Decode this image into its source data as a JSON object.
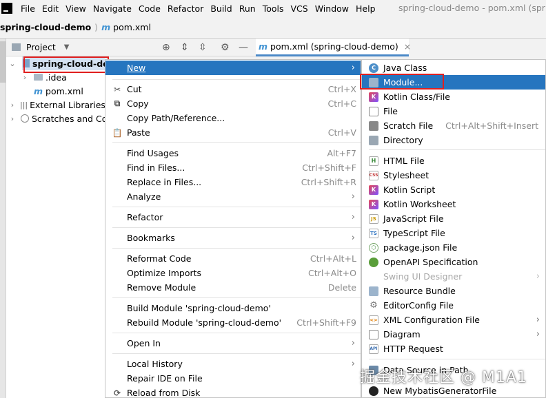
{
  "menubar": {
    "items": [
      "File",
      "Edit",
      "View",
      "Navigate",
      "Code",
      "Refactor",
      "Build",
      "Run",
      "Tools",
      "VCS",
      "Window",
      "Help"
    ],
    "window_title": "spring-cloud-demo - pom.xml (spring"
  },
  "navbar": {
    "project": "spring-cloud-demo",
    "file": "pom.xml"
  },
  "project_panel": {
    "title": "Project"
  },
  "editor_tab": {
    "label": "pom.xml (spring-cloud-demo)"
  },
  "tree": {
    "root": "spring-cloud-demo",
    "items": [
      ".idea",
      "pom.xml",
      "External Libraries",
      "Scratches and Co"
    ]
  },
  "context_menu": {
    "new": "New",
    "cut": "Cut",
    "cut_sc": "Ctrl+X",
    "copy": "Copy",
    "copy_sc": "Ctrl+C",
    "copy_path": "Copy Path/Reference...",
    "paste": "Paste",
    "paste_sc": "Ctrl+V",
    "find_usages": "Find Usages",
    "find_usages_sc": "Alt+F7",
    "find_in_files": "Find in Files...",
    "find_in_files_sc": "Ctrl+Shift+F",
    "replace_in_files": "Replace in Files...",
    "replace_in_files_sc": "Ctrl+Shift+R",
    "analyze": "Analyze",
    "refactor": "Refactor",
    "bookmarks": "Bookmarks",
    "reformat": "Reformat Code",
    "reformat_sc": "Ctrl+Alt+L",
    "optimize": "Optimize Imports",
    "optimize_sc": "Ctrl+Alt+O",
    "remove_module": "Remove Module",
    "remove_module_sc": "Delete",
    "build_module": "Build Module 'spring-cloud-demo'",
    "rebuild_module": "Rebuild Module 'spring-cloud-demo'",
    "rebuild_module_sc": "Ctrl+Shift+F9",
    "open_in": "Open In",
    "local_history": "Local History",
    "repair_ide": "Repair IDE on File",
    "reload": "Reload from Disk"
  },
  "submenu": {
    "java_class": "Java Class",
    "module": "Module...",
    "kotlin_class": "Kotlin Class/File",
    "file": "File",
    "scratch": "Scratch File",
    "scratch_sc": "Ctrl+Alt+Shift+Insert",
    "directory": "Directory",
    "html": "HTML File",
    "stylesheet": "Stylesheet",
    "kotlin_script": "Kotlin Script",
    "kotlin_ws": "Kotlin Worksheet",
    "js": "JavaScript File",
    "ts": "TypeScript File",
    "pkg_json": "package.json File",
    "openapi": "OpenAPI Specification",
    "swing": "Swing UI Designer",
    "resource_bundle": "Resource Bundle",
    "editorconfig": "EditorConfig File",
    "xml_config": "XML Configuration File",
    "diagram": "Diagram",
    "http": "HTTP Request",
    "data_source": "Data Source in Path",
    "mybatis": "New MybatisGeneratorFile"
  },
  "watermark": "掘金技术社区 @ M1A1",
  "colors": {
    "highlight": "#2675bf",
    "red_box": "#e01f1f",
    "selection": "#d5e1f2"
  }
}
